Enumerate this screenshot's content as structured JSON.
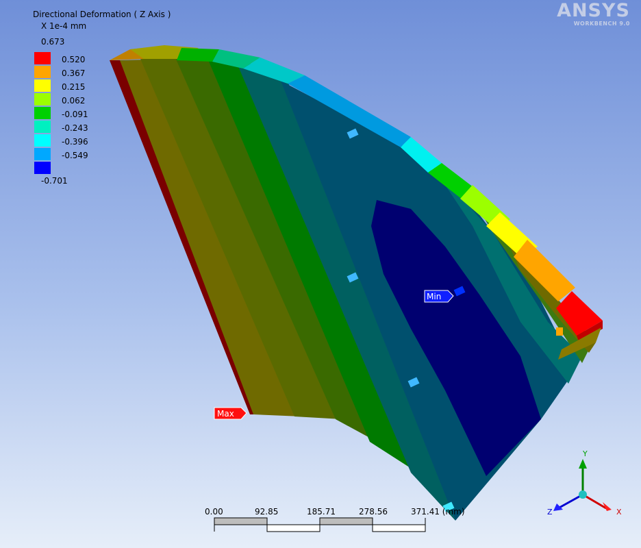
{
  "legend": {
    "title": "Directional Deformation ( Z Axis )",
    "unit": "X 1e-4 mm",
    "max": "0.673",
    "min": "-0.701",
    "bands": [
      {
        "label": "0.520",
        "color": "#ff0000"
      },
      {
        "label": "0.367",
        "color": "#ffa500"
      },
      {
        "label": "0.215",
        "color": "#ffff00"
      },
      {
        "label": "0.062",
        "color": "#9cff00"
      },
      {
        "label": "-0.091",
        "color": "#00d000"
      },
      {
        "label": "-0.243",
        "color": "#00f0c0"
      },
      {
        "label": "-0.396",
        "color": "#00ffff"
      },
      {
        "label": "-0.549",
        "color": "#00a8ff"
      },
      {
        "label": "",
        "color": "#0000ff"
      }
    ]
  },
  "brand": {
    "name": "ANSYS",
    "sub": "WORKBENCH 9.0"
  },
  "markers": {
    "max": "Max",
    "min": "Min"
  },
  "scale": {
    "ticks": [
      "0.00",
      "92.85",
      "185.71",
      "278.56",
      "371.41 (mm)"
    ]
  },
  "triad": {
    "x": "X",
    "y": "Y",
    "z": "Z"
  },
  "colors": {
    "band_dark_red": "#7a0000",
    "band_olive": "#6f6a00",
    "band_green_dark": "#4f6f00",
    "band_green": "#008000",
    "band_teal": "#006060",
    "band_steel": "#00506e",
    "band_navy": "#000070"
  }
}
